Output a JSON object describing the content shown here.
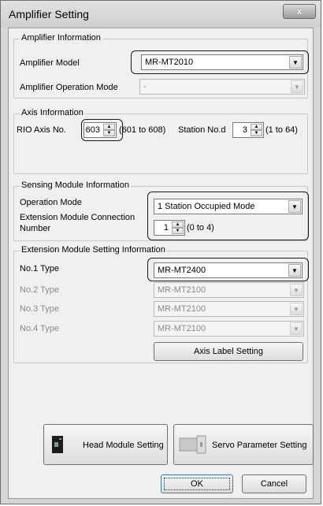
{
  "window": {
    "title": "Amplifier Setting",
    "close_label": "x"
  },
  "amp_info": {
    "group_label": "Amplifier Information",
    "model_label": "Amplifier Model",
    "model_value": "MR-MT2010",
    "mode_label": "Amplifier Operation Mode",
    "mode_value": "-"
  },
  "axis_info": {
    "group_label": "Axis Information",
    "rio_label": "RIO Axis No.",
    "rio_value": "603",
    "rio_range": "(601 to 608)",
    "station_label": "Station No.d",
    "station_value": "3",
    "station_range": "(1 to 64)"
  },
  "sensing": {
    "group_label": "Sensing Module Information",
    "op_mode_label": "Operation Mode",
    "op_mode_value": "1 Station Occupied Mode",
    "ext_label_1": "Extension Module Connection",
    "ext_label_2": "Number",
    "ext_value": "1",
    "ext_range": "(0 to 4)"
  },
  "extension": {
    "group_label": "Extension Module Setting Information",
    "types": [
      {
        "label": "No.1 Type",
        "value": "MR-MT2400",
        "enabled": true
      },
      {
        "label": "No.2 Type",
        "value": "MR-MT2100",
        "enabled": false
      },
      {
        "label": "No.3 Type",
        "value": "MR-MT2100",
        "enabled": false
      },
      {
        "label": "No.4 Type",
        "value": "MR-MT2100",
        "enabled": false
      }
    ],
    "axis_label_button": "Axis Label Setting"
  },
  "footer": {
    "head_module_button": "Head Module Setting",
    "servo_param_button": "Servo Parameter Setting",
    "ok_button": "OK",
    "cancel_button": "Cancel"
  },
  "colors": {
    "highlight_border": "#1a1a1a",
    "ok_border": "#3c7fb1",
    "panel_bg": "#f0f0f0"
  }
}
